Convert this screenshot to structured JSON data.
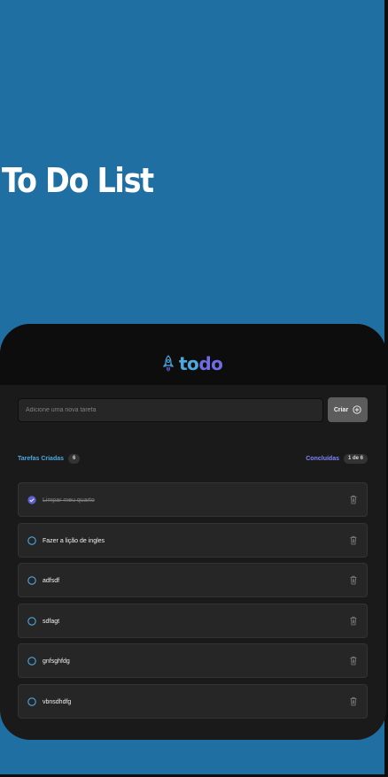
{
  "hero": {
    "title": "To Do List"
  },
  "app": {
    "logo_part1": "to",
    "logo_part2": "do",
    "input_placeholder": "Adicione uma nova tarefa",
    "create_label": "Criar"
  },
  "stats": {
    "created_label": "Tarefas Criadas",
    "created_count": "6",
    "done_label": "Concluídas",
    "done_count": "1 de 6"
  },
  "tasks": [
    {
      "text": "Limpar meu quarto",
      "done": true
    },
    {
      "text": "Fazer a lição de ingles",
      "done": false
    },
    {
      "text": "adfsdf",
      "done": false
    },
    {
      "text": "sdfagt",
      "done": false
    },
    {
      "text": "gnfsghfdg",
      "done": false
    },
    {
      "text": "vbnsdhdfg",
      "done": false
    }
  ],
  "colors": {
    "background": "#1f6fa3",
    "card": "#1a1a1a",
    "header": "#0d0d0d",
    "blue": "#4ea8de",
    "purple": "#8284fa",
    "purple_dark": "#5e60ce"
  }
}
